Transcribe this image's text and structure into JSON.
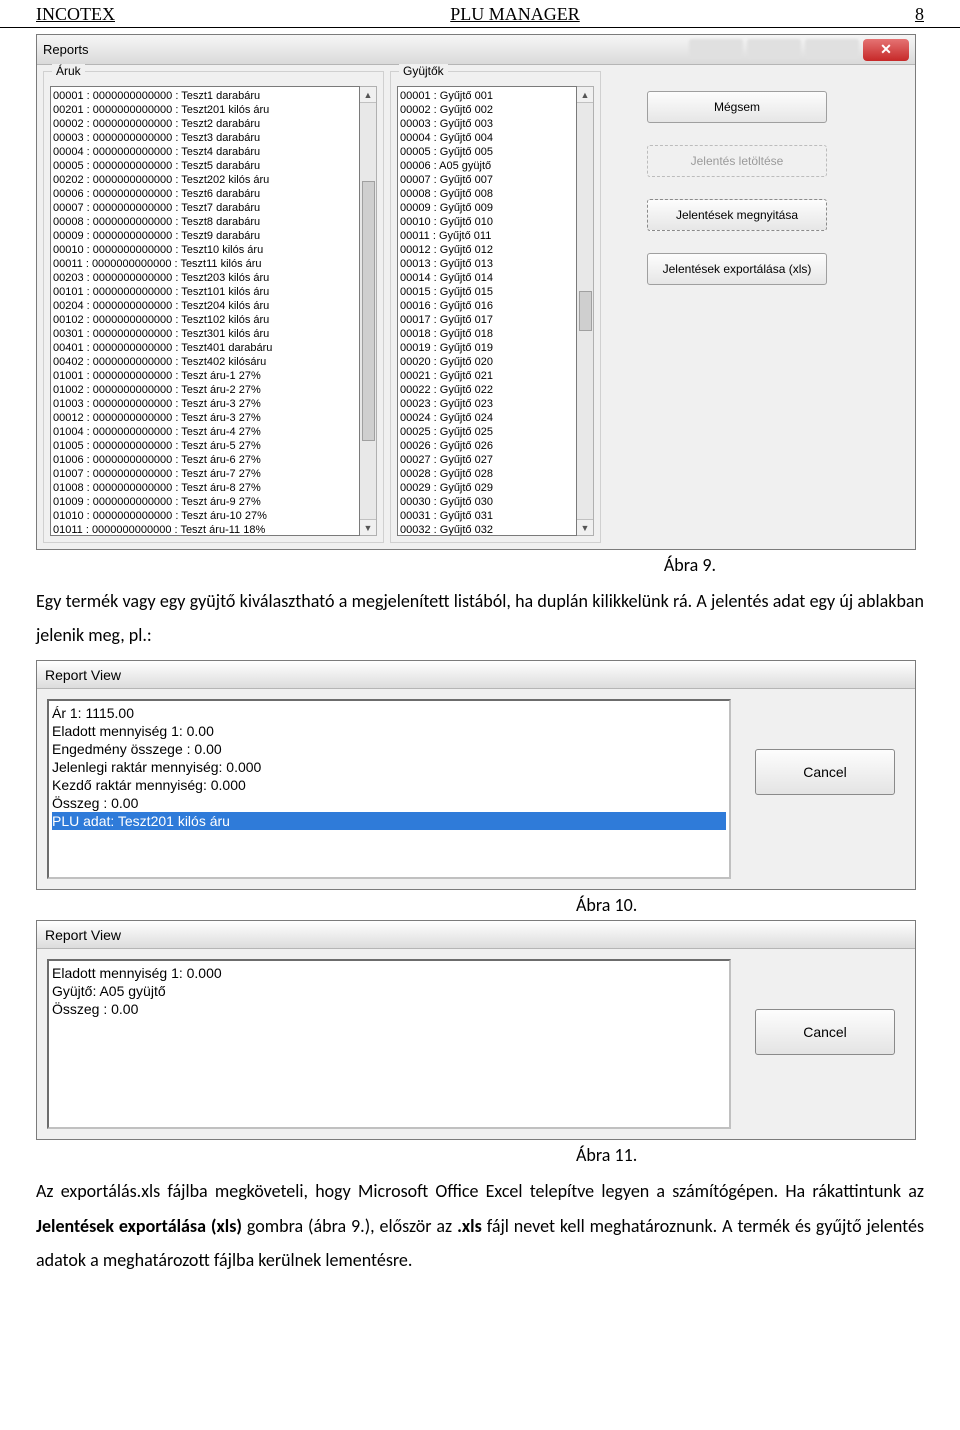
{
  "header": {
    "left": "INCOTEX",
    "center": "PLU MANAGER",
    "right": "8"
  },
  "reports": {
    "window_title": "Reports",
    "group_aruk": "Áruk",
    "group_gyujtok": "Gyüjtők",
    "aruk": [
      "00001 : 0000000000000 : Teszt1 darabáru",
      "00201 : 0000000000000 : Teszt201 kilós áru",
      "00002 : 0000000000000 : Teszt2 darabáru",
      "00003 : 0000000000000 : Teszt3 darabáru",
      "00004 : 0000000000000 : Teszt4 darabáru",
      "00005 : 0000000000000 : Teszt5 darabáru",
      "00202 : 0000000000000 : Teszt202 kilós áru",
      "00006 : 0000000000000 : Teszt6 darabáru",
      "00007 : 0000000000000 : Teszt7 darabáru",
      "00008 : 0000000000000 : Teszt8 darabáru",
      "00009 : 0000000000000 : Teszt9 darabáru",
      "00010 : 0000000000000 : Teszt10 kilós áru",
      "00011 : 0000000000000 : Teszt11 kilós áru",
      "00203 : 0000000000000 : Teszt203 kilós áru",
      "00101 : 0000000000000 : Teszt101 kilós áru",
      "00204 : 0000000000000 : Teszt204 kilós áru",
      "00102 : 0000000000000 : Teszt102 kilós áru",
      "00301 : 0000000000000 : Teszt301 kilós áru",
      "00401 : 0000000000000 : Teszt401 darabáru",
      "00402 : 0000000000000 : Teszt402 kilósáru",
      "01001 : 0000000000000 : Teszt áru-1 27%",
      "01002 : 0000000000000 : Teszt áru-2 27%",
      "01003 : 0000000000000 : Teszt áru-3 27%",
      "00012 : 0000000000000 : Teszt áru-3 27%",
      "01004 : 0000000000000 : Teszt áru-4 27%",
      "01005 : 0000000000000 : Teszt áru-5 27%",
      "01006 : 0000000000000 : Teszt áru-6 27%",
      "01007 : 0000000000000 : Teszt áru-7 27%",
      "01008 : 0000000000000 : Teszt áru-8 27%",
      "01009 : 0000000000000 : Teszt áru-9 27%",
      "01010 : 0000000000000 : Teszt áru-10 27%",
      "01011 : 0000000000000 : Teszt áru-11 18%"
    ],
    "gyujtok": [
      "00001 : Gyűjtő 001",
      "00002 : Gyűjtő 002",
      "00003 : Gyűjtő 003",
      "00004 : Gyűjtő 004",
      "00005 : Gyűjtő 005",
      "00006 : A05 gyüjtő",
      "00007 : Gyűjtő 007",
      "00008 : Gyűjtő 008",
      "00009 : Gyűjtő 009",
      "00010 : Gyűjtő 010",
      "00011 : Gyűjtő 011",
      "00012 : Gyűjtő 012",
      "00013 : Gyűjtő 013",
      "00014 : Gyűjtő 014",
      "00015 : Gyűjtő 015",
      "00016 : Gyűjtő 016",
      "00017 : Gyűjtő 017",
      "00018 : Gyűjtő 018",
      "00019 : Gyűjtő 019",
      "00020 : Gyűjtő 020",
      "00021 : Gyűjtő 021",
      "00022 : Gyűjtő 022",
      "00023 : Gyűjtő 023",
      "00024 : Gyűjtő 024",
      "00025 : Gyűjtő 025",
      "00026 : Gyűjtő 026",
      "00027 : Gyűjtő 027",
      "00028 : Gyűjtő 028",
      "00029 : Gyűjtő 029",
      "00030 : Gyűjtő 030",
      "00031 : Gyűjtő 031",
      "00032 : Gyűjtő 032"
    ],
    "buttons": {
      "megsem": "Mégsem",
      "letoltes": "Jelentés letöltése",
      "megnyitas": "Jelentések megnyitása",
      "export": "Jelentések exportálása (xls)"
    }
  },
  "fig9": "Ábra 9.",
  "para1": "Egy termék vagy egy gyüjtő kiválasztható a megjelenített listából, ha duplán kilikkelünk rá. A jelentés adat egy új ablakban jelenik meg, pl.:",
  "reportview1": {
    "title": "Report View",
    "lines": [
      "Ár 1: 1115.00",
      "Eladott mennyiség 1: 0.00",
      "Engedmény összege : 0.00",
      "Jelenlegi raktár mennyiség: 0.000",
      "Kezdő raktár mennyiség: 0.000",
      "Összeg : 0.00"
    ],
    "selected": "PLU adat: Teszt201 kilós áru",
    "cancel": "Cancel"
  },
  "fig10": "Ábra 10.",
  "reportview2": {
    "title": "Report View",
    "lines": [
      "Eladott mennyiség 1: 0.000",
      "Gyüjtő: A05 gyüjtő",
      "Összeg : 0.00"
    ],
    "cancel": "Cancel"
  },
  "fig11": "Ábra 11.",
  "para2_plain_1": "Az exportálás.xls fájlba megköveteli, hogy Microsoft Office Excel telepítve legyen a számítógépen. Ha rákattintunk az ",
  "para2_bold_1": "Jelentések exportálása (xls)",
  "para2_plain_2": " gombra (ábra 9.), először az ",
  "para2_bold_2": ".xls",
  "para2_plain_3": " fájl nevet kell meghatároznunk. A termék és gyűjtő jelentés adatok a meghatározott fájlba kerülnek lementésre."
}
